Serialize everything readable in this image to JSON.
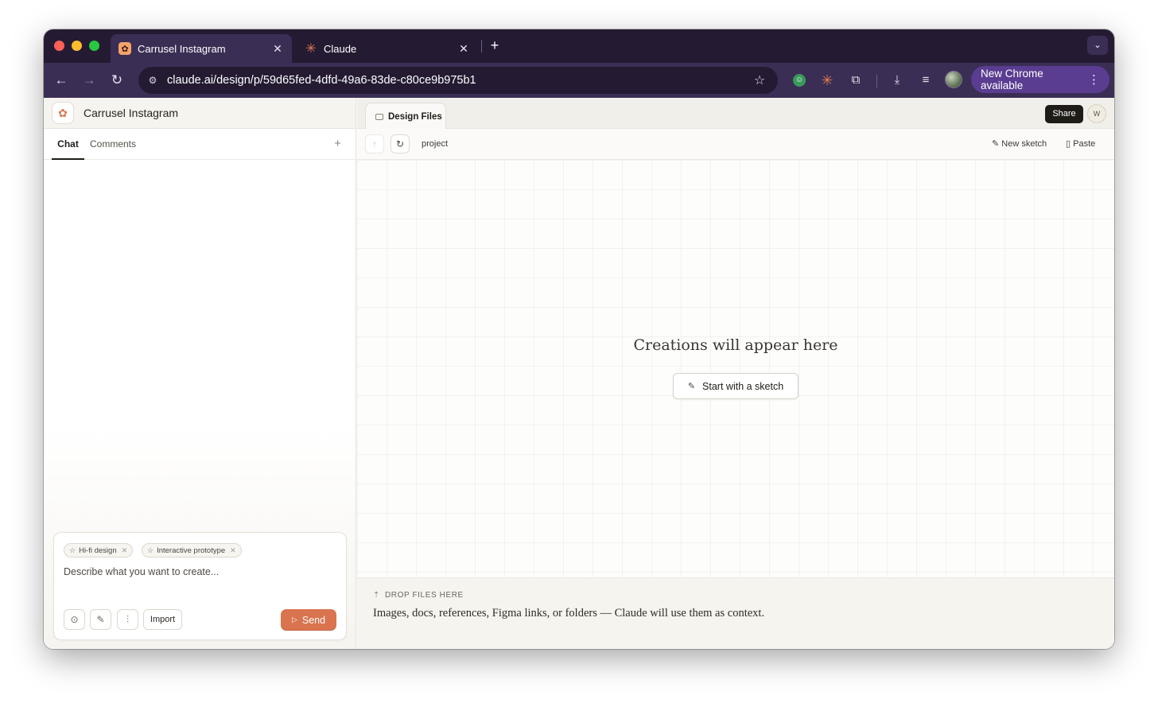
{
  "browser": {
    "tabs": [
      {
        "title": "Carrusel Instagram",
        "favicon": "palette-icon",
        "active": true
      },
      {
        "title": "Claude",
        "favicon": "claude-asterisk-icon",
        "active": false
      }
    ],
    "tab_close_glyph": "✕",
    "new_tab_glyph": "+",
    "tab_menu_glyph": "⌄",
    "nav": {
      "back": "←",
      "forward": "→",
      "reload": "↻"
    },
    "url": "claude.ai/design/p/59d65fed-4dfd-49a6-83de-c80ce9b975b1",
    "bookmark_glyph": "☆",
    "toolbar_icons": [
      "extension-green-icon",
      "claude-extension-icon",
      "puzzle-extensions-icon",
      "download-icon",
      "media-controls-icon",
      "profile-avatar"
    ],
    "update_button_label": "New Chrome available",
    "update_menu_glyph": "⋮",
    "accent_colors": {
      "tabstrip": "#241b33",
      "toolbar": "#3b2e55",
      "update": "#5a3d91"
    }
  },
  "project": {
    "title": "Carrusel Instagram",
    "icon": "palette-icon"
  },
  "left_tabs": {
    "chat": "Chat",
    "comments": "Comments",
    "add_glyph": "+"
  },
  "composer": {
    "chips": [
      {
        "label": "Hi-fi design"
      },
      {
        "label": "Interactive prototype"
      }
    ],
    "placeholder": "Describe what you want to create...",
    "tool_icons": [
      "settings-icon",
      "attach-icon",
      "audio-icon"
    ],
    "import_label": "Import",
    "send_label": "Send",
    "send_color": "#d9744f"
  },
  "right": {
    "tab_label": "Design Files",
    "share_label": "Share",
    "avatar_initial": "W",
    "path_label": "project",
    "new_sketch_label": "New sketch",
    "paste_label": "Paste",
    "empty_title": "Creations will appear here",
    "sketch_button_label": "Start with a sketch",
    "drop_label": "DROP FILES HERE",
    "drop_description": "Images, docs, references, Figma links, or folders — Claude will use them as context."
  }
}
